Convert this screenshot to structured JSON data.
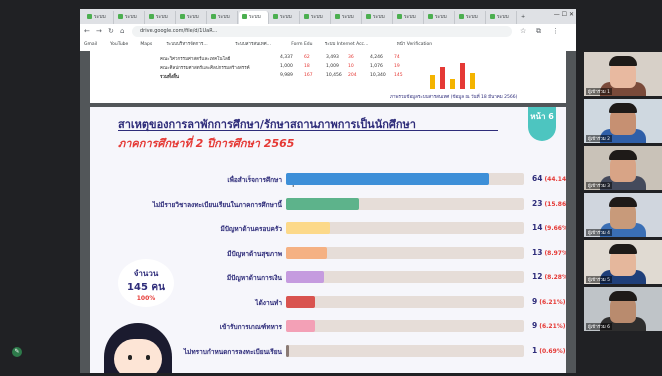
{
  "browser": {
    "tabs": [
      {
        "label": "ระบบ"
      },
      {
        "label": "ระบบ"
      },
      {
        "label": "ระบบ"
      },
      {
        "label": "ระบบ"
      },
      {
        "label": "ระบบ"
      },
      {
        "label": "ระบบ"
      },
      {
        "label": "ระบบ"
      },
      {
        "label": "ระบบ"
      },
      {
        "label": "ระบบ"
      },
      {
        "label": "ระบบ"
      },
      {
        "label": "ระบบ"
      },
      {
        "label": "ระบบ"
      },
      {
        "label": "ระบบ"
      },
      {
        "label": "ระบบ"
      }
    ],
    "new_tab": "+",
    "url": "drive.google.com/file/d/1UaR...",
    "bookmarks": [
      "Gmail",
      "YouTube",
      "Maps",
      "ระบบบริหารจัดการ...",
      "ระบบสารสนเทศ...",
      "Form Edu",
      "ระบบ Internet Acc...",
      "หน้า Verification"
    ]
  },
  "prev_page": {
    "rows": [
      {
        "label": "คณะวิศวกรรมศาสตร์และเทคโนโลยี",
        "a": "4,337",
        "b": "62",
        "c": "3,493",
        "d": "36",
        "e": "4,246",
        "f": "74"
      },
      {
        "label": "คณะศิลปกรรมศาสตร์และศิลปกรรมสร้างสรรค์",
        "a": "1,000",
        "b": "18",
        "c": "1,009",
        "d": "10",
        "e": "1,076",
        "f": "19"
      },
      {
        "label": "รวมทั้งสิ้น",
        "a": "9,989",
        "b": "167",
        "c": "10,456",
        "d": "204",
        "e": "10,340",
        "f": "145"
      }
    ],
    "note": "ภาพรวมข้อมูลระบบสารสนเทศ (ข้อมูล ณ วันที่ 18 มีนาคม 2566)"
  },
  "slide": {
    "title": "สาเหตุของการลาพักการศึกษา/รักษาสถานภาพการเป็นนักศึกษา",
    "subtitle": "ภาคการศึกษาที่ 2 ปีการศึกษา 2565",
    "page_badge": "หน้า 6",
    "total_label": "จำนวน",
    "total_value": "145 คน",
    "total_pct": "100%"
  },
  "chart_data": {
    "type": "bar",
    "orientation": "horizontal",
    "categories": [
      "เพื่อสำเร็จการศึกษา",
      "ไม่มีรายวิชาลงทะเบียนเรียนในภาคการศึกษานี้",
      "มีปัญหาด้านครอบครัว",
      "มีปัญหาด้านสุขภาพ",
      "มีปัญหาด้านการเงิน",
      "ได้งานทำ",
      "เข้ารับการเกณฑ์ทหาร",
      "ไม่ทราบกำหนดการลงทะเบียนเรียน"
    ],
    "values": [
      64,
      23,
      14,
      13,
      12,
      9,
      9,
      1
    ],
    "percent_labels": [
      "(44.14%)",
      "(15.86%)",
      "(9.66%)",
      "(8.97%)",
      "(8.28%)",
      "(6.21%)",
      "(6.21%)",
      "(0.69%)"
    ],
    "colors": [
      "#3d8fd8",
      "#5db38b",
      "#fcd98a",
      "#f5b183",
      "#c59bdf",
      "#d9534f",
      "#f3a0b6",
      "#8a7a74"
    ],
    "xlim": [
      0,
      75
    ]
  },
  "meeting": {
    "participants": [
      {
        "name": "ผู้เข้าร่วม 1",
        "bg": "#d7d0c8",
        "skin": "#e8b9a0",
        "shirt": "#7a4a3a"
      },
      {
        "name": "ผู้เข้าร่วม 2",
        "bg": "#cfd8e0",
        "skin": "#c69072",
        "shirt": "#2f5fa8"
      },
      {
        "name": "ผู้เข้าร่วม 3",
        "bg": "#c9c2b8",
        "skin": "#d8a486",
        "shirt": "#444a5c"
      },
      {
        "name": "ผู้เข้าร่วม 4",
        "bg": "#d0d6de",
        "skin": "#c89a7a",
        "shirt": "#3a6fb5"
      },
      {
        "name": "ผู้เข้าร่วม 5",
        "bg": "#e0dad2",
        "skin": "#e5b79c",
        "shirt": "#1f3f7a"
      },
      {
        "name": "ผู้เข้าร่วม 6",
        "bg": "#bfc4c8",
        "skin": "#b98b6e",
        "shirt": "#2e2e2e"
      }
    ]
  }
}
